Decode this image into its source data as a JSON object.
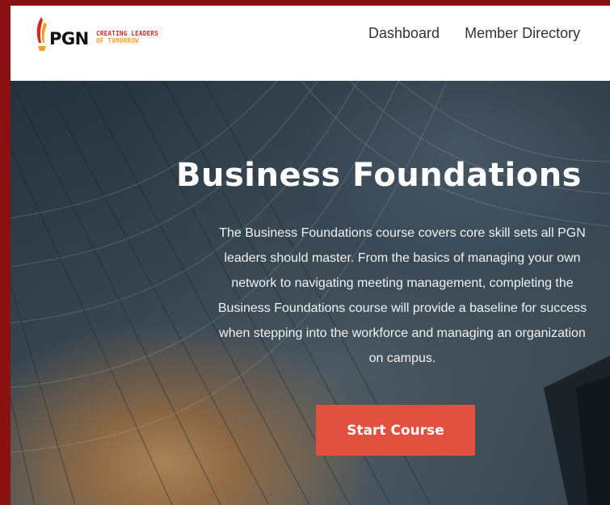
{
  "header": {
    "logo_text": "PGN",
    "logo_tagline_line1": "CREATING LEADERS",
    "logo_tagline_line2": "OF TOMORROW",
    "nav": [
      "Dashboard",
      "Member Directory"
    ]
  },
  "hero": {
    "title": "Business Foundations",
    "description_lines": [
      "The Business Foundations course covers core skill sets all PGN",
      "leaders should master. From the basics of managing your own",
      "network to navigating meeting management, completing the",
      "Business Foundations course will provide a baseline for success",
      "when stepping into the workforce and managing an organization",
      "on campus."
    ],
    "cta_label": "Start Course"
  },
  "colors": {
    "frame": "#8a1012",
    "cta": "#e2513f",
    "brand_red": "#d7261e",
    "brand_orange": "#f2a01c"
  }
}
